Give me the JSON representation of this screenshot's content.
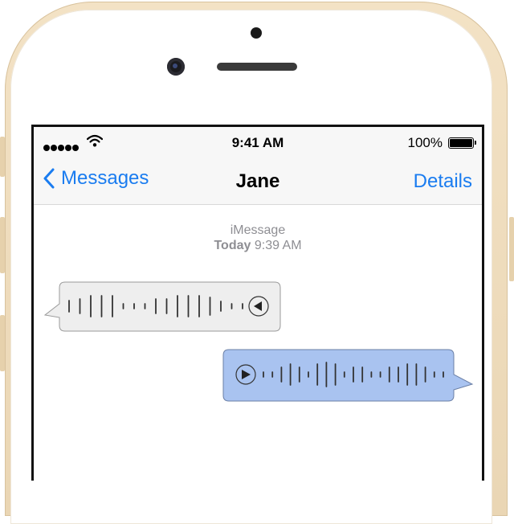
{
  "status": {
    "time": "9:41 AM",
    "battery": "100%"
  },
  "nav": {
    "back_label": "Messages",
    "title": "Jane",
    "details_label": "Details"
  },
  "thread": {
    "service": "iMessage",
    "day": "Today",
    "time": "9:39 AM"
  },
  "messages": [
    {
      "direction": "incoming",
      "type": "audio",
      "color": "#eeeeee",
      "waveform_heights": [
        14,
        18,
        26,
        26,
        26,
        6,
        6,
        6,
        18,
        18,
        26,
        26,
        26,
        22,
        12,
        6,
        6
      ]
    },
    {
      "direction": "outgoing",
      "type": "audio",
      "color": "#a9c3f0",
      "waveform_heights": [
        6,
        6,
        18,
        26,
        18,
        6,
        26,
        30,
        26,
        6,
        18,
        18,
        6,
        6,
        18,
        18,
        26,
        26,
        18,
        6,
        6
      ]
    }
  ],
  "colors": {
    "accent": "#1a7cf0",
    "incoming_bubble": "#eeeeee",
    "outgoing_bubble": "#a9c3f0",
    "phone_frame": "#ead6b4"
  }
}
